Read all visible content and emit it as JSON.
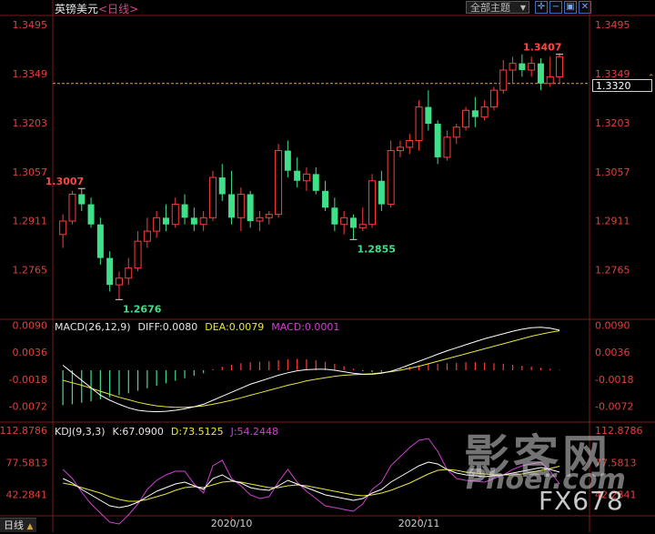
{
  "header": {
    "symbol": "英镑美元",
    "period": "<日线>",
    "theme_label": "全部主题",
    "tool_icons": [
      "crosshair-icon",
      "zoom-out-icon",
      "restore-icon",
      "close-icon"
    ]
  },
  "price_axis": {
    "ticks": [
      "1.3495",
      "1.3349",
      "1.3203",
      "1.3057",
      "1.2911",
      "1.2765"
    ]
  },
  "current_price": "1.3320",
  "annotations": [
    {
      "text": "1.3407",
      "value": 1.3407,
      "color": "#ff4444"
    },
    {
      "text": "1.3007",
      "value": 1.3007,
      "color": "#ff4444"
    },
    {
      "text": "1.2855",
      "value": 1.2855,
      "color": "#44dd88"
    },
    {
      "text": "1.2676",
      "value": 1.2676,
      "color": "#44dd88"
    }
  ],
  "macd": {
    "label": "MACD(26,12,9)",
    "diff": "DIFF:0.0080",
    "dea": "DEA:0.0079",
    "macd": "MACD:0.0001",
    "ticks": [
      "0.0090",
      "0.0036",
      "-0.0018",
      "-0.0072"
    ]
  },
  "kdj": {
    "label": "KDJ(9,3,3)",
    "k": "K:67.0900",
    "d": "D:73.5125",
    "j": "J:54.2448",
    "ticks": [
      "112.8786",
      "77.5813",
      "42.2841"
    ]
  },
  "x_axis": {
    "labels": [
      "2020/10",
      "2020/11"
    ]
  },
  "bottom_tab": "日线",
  "watermark": {
    "main": "影客网",
    "sub": "Phoer.com",
    "code": "FX678"
  },
  "colors": {
    "up": "#ff3b3b",
    "down": "#3fe08a",
    "diff": "#ffffff",
    "dea": "#e8e83a",
    "j": "#d040d0",
    "dashed": "#e0a040"
  },
  "chart_data": [
    {
      "type": "candlestick",
      "title": "英镑美元 <日线>",
      "ylim": [
        1.262,
        1.352
      ],
      "candles": [
        {
          "o": 1.287,
          "h": 1.293,
          "l": 1.283,
          "c": 1.291
        },
        {
          "o": 1.291,
          "h": 1.3,
          "l": 1.29,
          "c": 1.299
        },
        {
          "o": 1.299,
          "h": 1.3007,
          "l": 1.294,
          "c": 1.296
        },
        {
          "o": 1.296,
          "h": 1.298,
          "l": 1.289,
          "c": 1.29
        },
        {
          "o": 1.29,
          "h": 1.292,
          "l": 1.278,
          "c": 1.28
        },
        {
          "o": 1.28,
          "h": 1.282,
          "l": 1.27,
          "c": 1.272
        },
        {
          "o": 1.272,
          "h": 1.276,
          "l": 1.2676,
          "c": 1.274
        },
        {
          "o": 1.274,
          "h": 1.28,
          "l": 1.272,
          "c": 1.277
        },
        {
          "o": 1.277,
          "h": 1.288,
          "l": 1.276,
          "c": 1.285
        },
        {
          "o": 1.285,
          "h": 1.292,
          "l": 1.283,
          "c": 1.288
        },
        {
          "o": 1.288,
          "h": 1.294,
          "l": 1.286,
          "c": 1.292
        },
        {
          "o": 1.292,
          "h": 1.296,
          "l": 1.288,
          "c": 1.29
        },
        {
          "o": 1.29,
          "h": 1.298,
          "l": 1.289,
          "c": 1.296
        },
        {
          "o": 1.296,
          "h": 1.299,
          "l": 1.29,
          "c": 1.292
        },
        {
          "o": 1.292,
          "h": 1.295,
          "l": 1.288,
          "c": 1.29
        },
        {
          "o": 1.29,
          "h": 1.294,
          "l": 1.288,
          "c": 1.292
        },
        {
          "o": 1.292,
          "h": 1.306,
          "l": 1.291,
          "c": 1.304
        },
        {
          "o": 1.304,
          "h": 1.308,
          "l": 1.297,
          "c": 1.299
        },
        {
          "o": 1.299,
          "h": 1.306,
          "l": 1.29,
          "c": 1.292
        },
        {
          "o": 1.292,
          "h": 1.301,
          "l": 1.288,
          "c": 1.299
        },
        {
          "o": 1.299,
          "h": 1.3,
          "l": 1.289,
          "c": 1.291
        },
        {
          "o": 1.291,
          "h": 1.294,
          "l": 1.288,
          "c": 1.292
        },
        {
          "o": 1.292,
          "h": 1.294,
          "l": 1.29,
          "c": 1.293
        },
        {
          "o": 1.293,
          "h": 1.314,
          "l": 1.292,
          "c": 1.312
        },
        {
          "o": 1.312,
          "h": 1.315,
          "l": 1.304,
          "c": 1.306
        },
        {
          "o": 1.306,
          "h": 1.31,
          "l": 1.301,
          "c": 1.303
        },
        {
          "o": 1.303,
          "h": 1.307,
          "l": 1.3,
          "c": 1.305
        },
        {
          "o": 1.305,
          "h": 1.307,
          "l": 1.299,
          "c": 1.3
        },
        {
          "o": 1.3,
          "h": 1.303,
          "l": 1.294,
          "c": 1.295
        },
        {
          "o": 1.295,
          "h": 1.298,
          "l": 1.288,
          "c": 1.29
        },
        {
          "o": 1.29,
          "h": 1.294,
          "l": 1.287,
          "c": 1.292
        },
        {
          "o": 1.292,
          "h": 1.293,
          "l": 1.2855,
          "c": 1.289
        },
        {
          "o": 1.289,
          "h": 1.295,
          "l": 1.288,
          "c": 1.29
        },
        {
          "o": 1.29,
          "h": 1.305,
          "l": 1.289,
          "c": 1.303
        },
        {
          "o": 1.303,
          "h": 1.306,
          "l": 1.294,
          "c": 1.296
        },
        {
          "o": 1.296,
          "h": 1.315,
          "l": 1.295,
          "c": 1.312
        },
        {
          "o": 1.312,
          "h": 1.315,
          "l": 1.31,
          "c": 1.313
        },
        {
          "o": 1.313,
          "h": 1.317,
          "l": 1.311,
          "c": 1.315
        },
        {
          "o": 1.315,
          "h": 1.327,
          "l": 1.312,
          "c": 1.325
        },
        {
          "o": 1.325,
          "h": 1.33,
          "l": 1.318,
          "c": 1.32
        },
        {
          "o": 1.32,
          "h": 1.321,
          "l": 1.308,
          "c": 1.31
        },
        {
          "o": 1.31,
          "h": 1.318,
          "l": 1.309,
          "c": 1.316
        },
        {
          "o": 1.316,
          "h": 1.32,
          "l": 1.314,
          "c": 1.319
        },
        {
          "o": 1.319,
          "h": 1.325,
          "l": 1.318,
          "c": 1.324
        },
        {
          "o": 1.324,
          "h": 1.328,
          "l": 1.319,
          "c": 1.322
        },
        {
          "o": 1.322,
          "h": 1.327,
          "l": 1.321,
          "c": 1.325
        },
        {
          "o": 1.325,
          "h": 1.331,
          "l": 1.324,
          "c": 1.33
        },
        {
          "o": 1.33,
          "h": 1.339,
          "l": 1.329,
          "c": 1.336
        },
        {
          "o": 1.336,
          "h": 1.34,
          "l": 1.332,
          "c": 1.338
        },
        {
          "o": 1.338,
          "h": 1.3407,
          "l": 1.334,
          "c": 1.336
        },
        {
          "o": 1.336,
          "h": 1.34,
          "l": 1.334,
          "c": 1.338
        },
        {
          "o": 1.338,
          "h": 1.3395,
          "l": 1.33,
          "c": 1.332
        },
        {
          "o": 1.332,
          "h": 1.34,
          "l": 1.331,
          "c": 1.334
        },
        {
          "o": 1.334,
          "h": 1.341,
          "l": 1.332,
          "c": 1.34
        }
      ]
    },
    {
      "type": "bar+line",
      "title": "MACD(26,12,9)",
      "ylim": [
        -0.01,
        0.01
      ],
      "macd_bars": [
        -0.007,
        -0.0068,
        -0.0065,
        -0.0062,
        -0.0058,
        -0.0054,
        -0.005,
        -0.0046,
        -0.0041,
        -0.0036,
        -0.0031,
        -0.0026,
        -0.0021,
        -0.0016,
        -0.0011,
        -0.0006,
        0.0002,
        0.0007,
        0.0011,
        0.0014,
        0.0016,
        0.0017,
        0.0018,
        0.002,
        0.0022,
        0.0023,
        0.0022,
        0.002,
        0.0017,
        0.0013,
        0.0008,
        0.0003,
        -0.0002,
        -0.0004,
        -0.0003,
        0.0,
        0.0004,
        0.0007,
        0.001,
        0.0012,
        0.0013,
        0.0014,
        0.0015,
        0.0016,
        0.0016,
        0.0015,
        0.0014,
        0.0013,
        0.0011,
        0.0009,
        0.0007,
        0.0005,
        0.0003,
        0.0001
      ],
      "diff": [
        0.001,
        -0.0005,
        -0.002,
        -0.0035,
        -0.005,
        -0.006,
        -0.0068,
        -0.0075,
        -0.008,
        -0.0082,
        -0.0083,
        -0.0082,
        -0.008,
        -0.0077,
        -0.0073,
        -0.0068,
        -0.006,
        -0.0052,
        -0.0044,
        -0.0036,
        -0.0028,
        -0.0022,
        -0.0016,
        -0.001,
        -0.0005,
        -0.0001,
        0.0001,
        0.0002,
        0.0002,
        0.0,
        -0.0003,
        -0.0006,
        -0.0008,
        -0.0008,
        -0.0006,
        -0.0002,
        0.0004,
        0.0011,
        0.0018,
        0.0025,
        0.0032,
        0.0039,
        0.0045,
        0.0051,
        0.0057,
        0.0063,
        0.0068,
        0.0073,
        0.0078,
        0.0082,
        0.0085,
        0.0086,
        0.0084,
        0.008
      ],
      "dea": [
        -0.002,
        -0.0025,
        -0.003,
        -0.0036,
        -0.0042,
        -0.0048,
        -0.0054,
        -0.0059,
        -0.0064,
        -0.0068,
        -0.0071,
        -0.0073,
        -0.0074,
        -0.0074,
        -0.0073,
        -0.0071,
        -0.0068,
        -0.0064,
        -0.006,
        -0.0055,
        -0.005,
        -0.0045,
        -0.004,
        -0.0035,
        -0.003,
        -0.0026,
        -0.0021,
        -0.0018,
        -0.0015,
        -0.0012,
        -0.001,
        -0.0009,
        -0.0008,
        -0.0007,
        -0.0005,
        -0.0003,
        0.0,
        0.0004,
        0.0008,
        0.0013,
        0.0018,
        0.0023,
        0.0028,
        0.0033,
        0.0038,
        0.0043,
        0.0048,
        0.0053,
        0.0058,
        0.0063,
        0.0068,
        0.0072,
        0.0076,
        0.0079
      ]
    },
    {
      "type": "line",
      "title": "KDJ(9,3,3)",
      "ylim": [
        20,
        120
      ],
      "k": [
        60,
        55,
        48,
        42,
        36,
        30,
        28,
        30,
        34,
        40,
        46,
        50,
        54,
        56,
        52,
        48,
        60,
        64,
        58,
        55,
        50,
        48,
        47,
        52,
        58,
        54,
        50,
        46,
        42,
        40,
        38,
        36,
        38,
        44,
        48,
        56,
        62,
        68,
        74,
        78,
        76,
        70,
        66,
        64,
        63,
        62,
        63,
        64,
        66,
        68,
        70,
        72,
        70,
        67
      ],
      "d": [
        55,
        53,
        50,
        47,
        44,
        40,
        37,
        35,
        35,
        37,
        40,
        43,
        47,
        50,
        51,
        50,
        53,
        56,
        57,
        56,
        54,
        52,
        50,
        50,
        52,
        53,
        52,
        50,
        48,
        46,
        44,
        42,
        41,
        42,
        44,
        47,
        51,
        55,
        60,
        65,
        69,
        70,
        69,
        67,
        66,
        65,
        64,
        64,
        64,
        65,
        67,
        69,
        71,
        73.5
      ],
      "j": [
        70,
        60,
        45,
        32,
        22,
        12,
        10,
        20,
        32,
        48,
        58,
        64,
        68,
        68,
        54,
        44,
        74,
        80,
        60,
        52,
        42,
        38,
        40,
        56,
        70,
        56,
        46,
        38,
        30,
        28,
        26,
        24,
        32,
        48,
        56,
        74,
        84,
        94,
        102,
        104,
        90,
        70,
        60,
        58,
        57,
        56,
        60,
        64,
        70,
        74,
        76,
        78,
        68,
        54
      ]
    }
  ]
}
